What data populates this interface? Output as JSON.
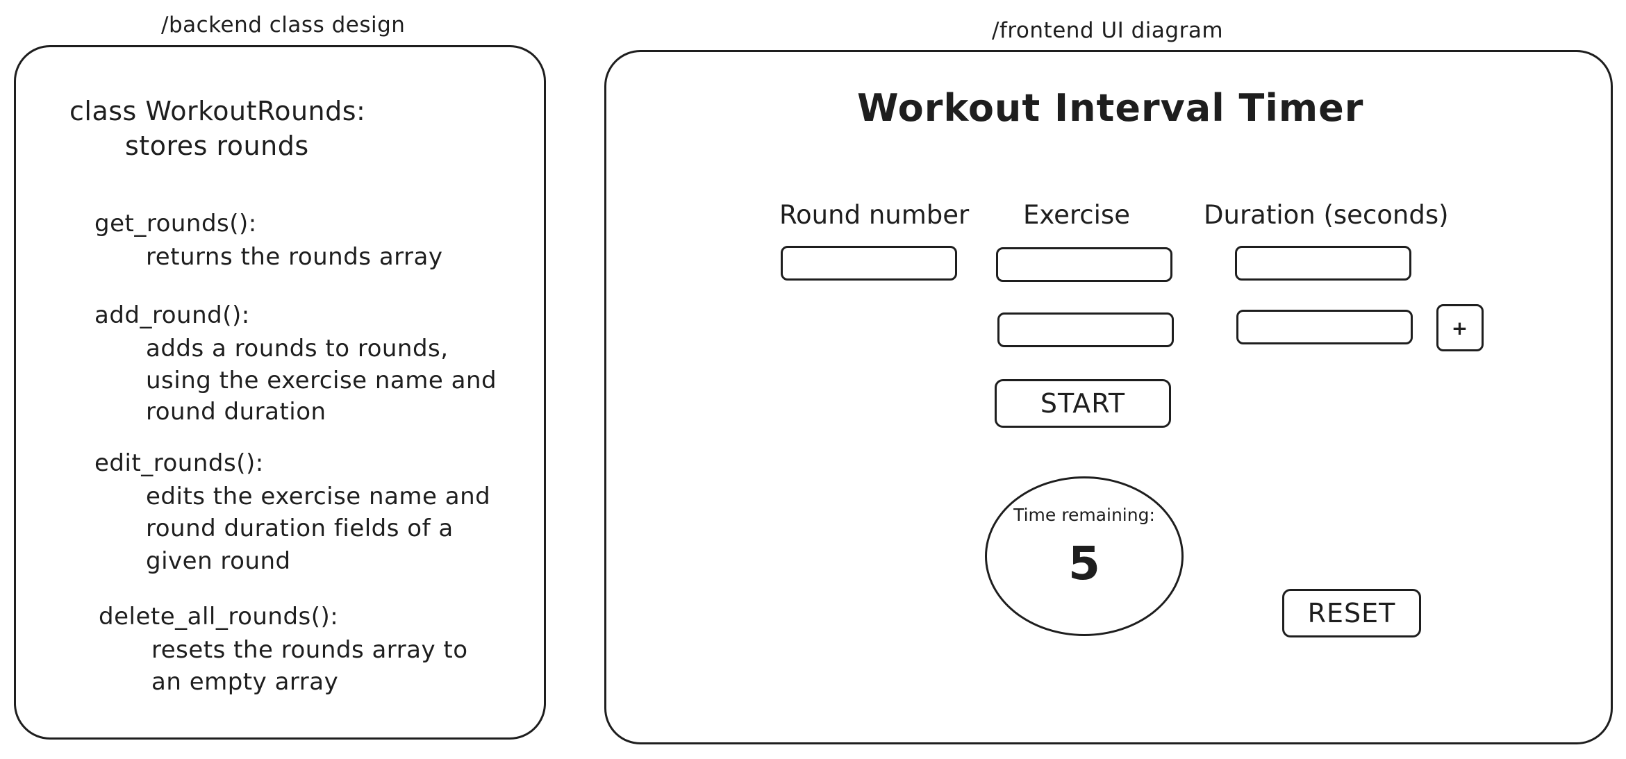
{
  "backend": {
    "caption": "/backend class design",
    "lines": [
      "class WorkoutRounds:",
      "stores rounds",
      "get_rounds():",
      "returns the rounds array",
      "add_round():",
      "adds a rounds to rounds,",
      "using the exercise name and",
      "round duration",
      "edit_rounds():",
      "edits the exercise name and",
      "round duration fields of a",
      "given round",
      "delete_all_rounds():",
      "resets the rounds array to",
      "an empty array"
    ]
  },
  "frontend": {
    "caption": "/frontend UI diagram",
    "title": "Workout Interval Timer",
    "columns": {
      "round_number": "Round number",
      "exercise": "Exercise",
      "duration": "Duration (seconds)"
    },
    "inputs": {
      "round_number_1": "",
      "exercise_1": "",
      "duration_1": "",
      "exercise_2": "",
      "duration_2": ""
    },
    "add_button": "+",
    "start_button": "START",
    "timer": {
      "label": "Time remaining:",
      "value": "5"
    },
    "reset_button": "RESET"
  }
}
